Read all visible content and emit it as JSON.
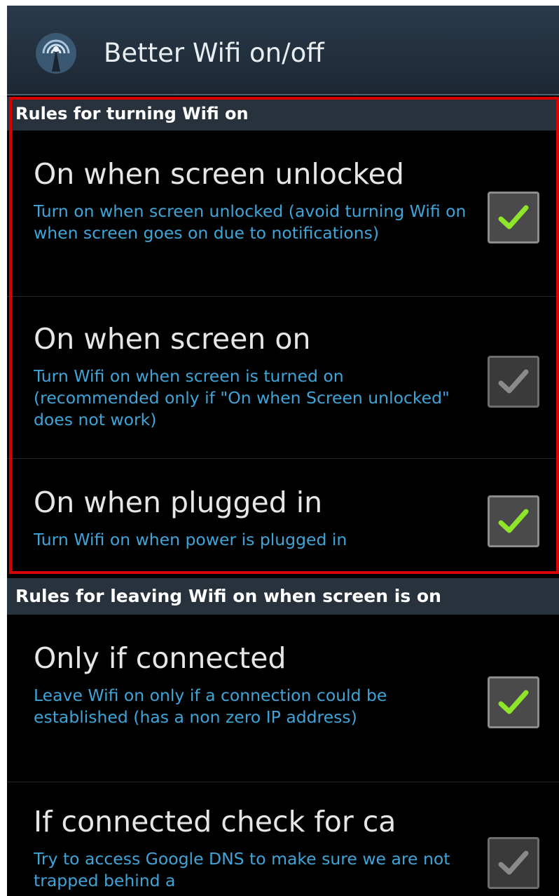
{
  "app": {
    "title": "Better Wifi on/off",
    "icon": "wifi-antenna-icon"
  },
  "sections": [
    {
      "header": "Rules for turning Wifi on",
      "items": [
        {
          "title": "On when screen unlocked",
          "summary": "Turn on when screen unlocked (avoid turning Wifi on when screen goes on due to notifications)",
          "checked": true,
          "enabled": true
        },
        {
          "title": "On when screen on",
          "summary": "Turn Wifi on when screen is turned on (recommended only if \"On when Screen unlocked\" does not work)",
          "checked": true,
          "enabled": false
        },
        {
          "title": "On when plugged in",
          "summary": "Turn Wifi on when power is plugged in",
          "checked": true,
          "enabled": true
        }
      ]
    },
    {
      "header": "Rules for leaving Wifi on when screen is on",
      "items": [
        {
          "title": "Only if connected",
          "summary": "Leave Wifi on only if a connection could be established (has a non zero IP address)",
          "checked": true,
          "enabled": true
        },
        {
          "title": "If connected check for ca",
          "summary": "Try to access Google DNS to make sure we are not trapped behind a",
          "checked": true,
          "enabled": false
        }
      ]
    }
  ],
  "colors": {
    "checkmark_enabled": "#8ee62a",
    "checkmark_disabled": "#8a8a8a",
    "summary_text": "#3fa4d8",
    "highlight": "#d90000"
  }
}
